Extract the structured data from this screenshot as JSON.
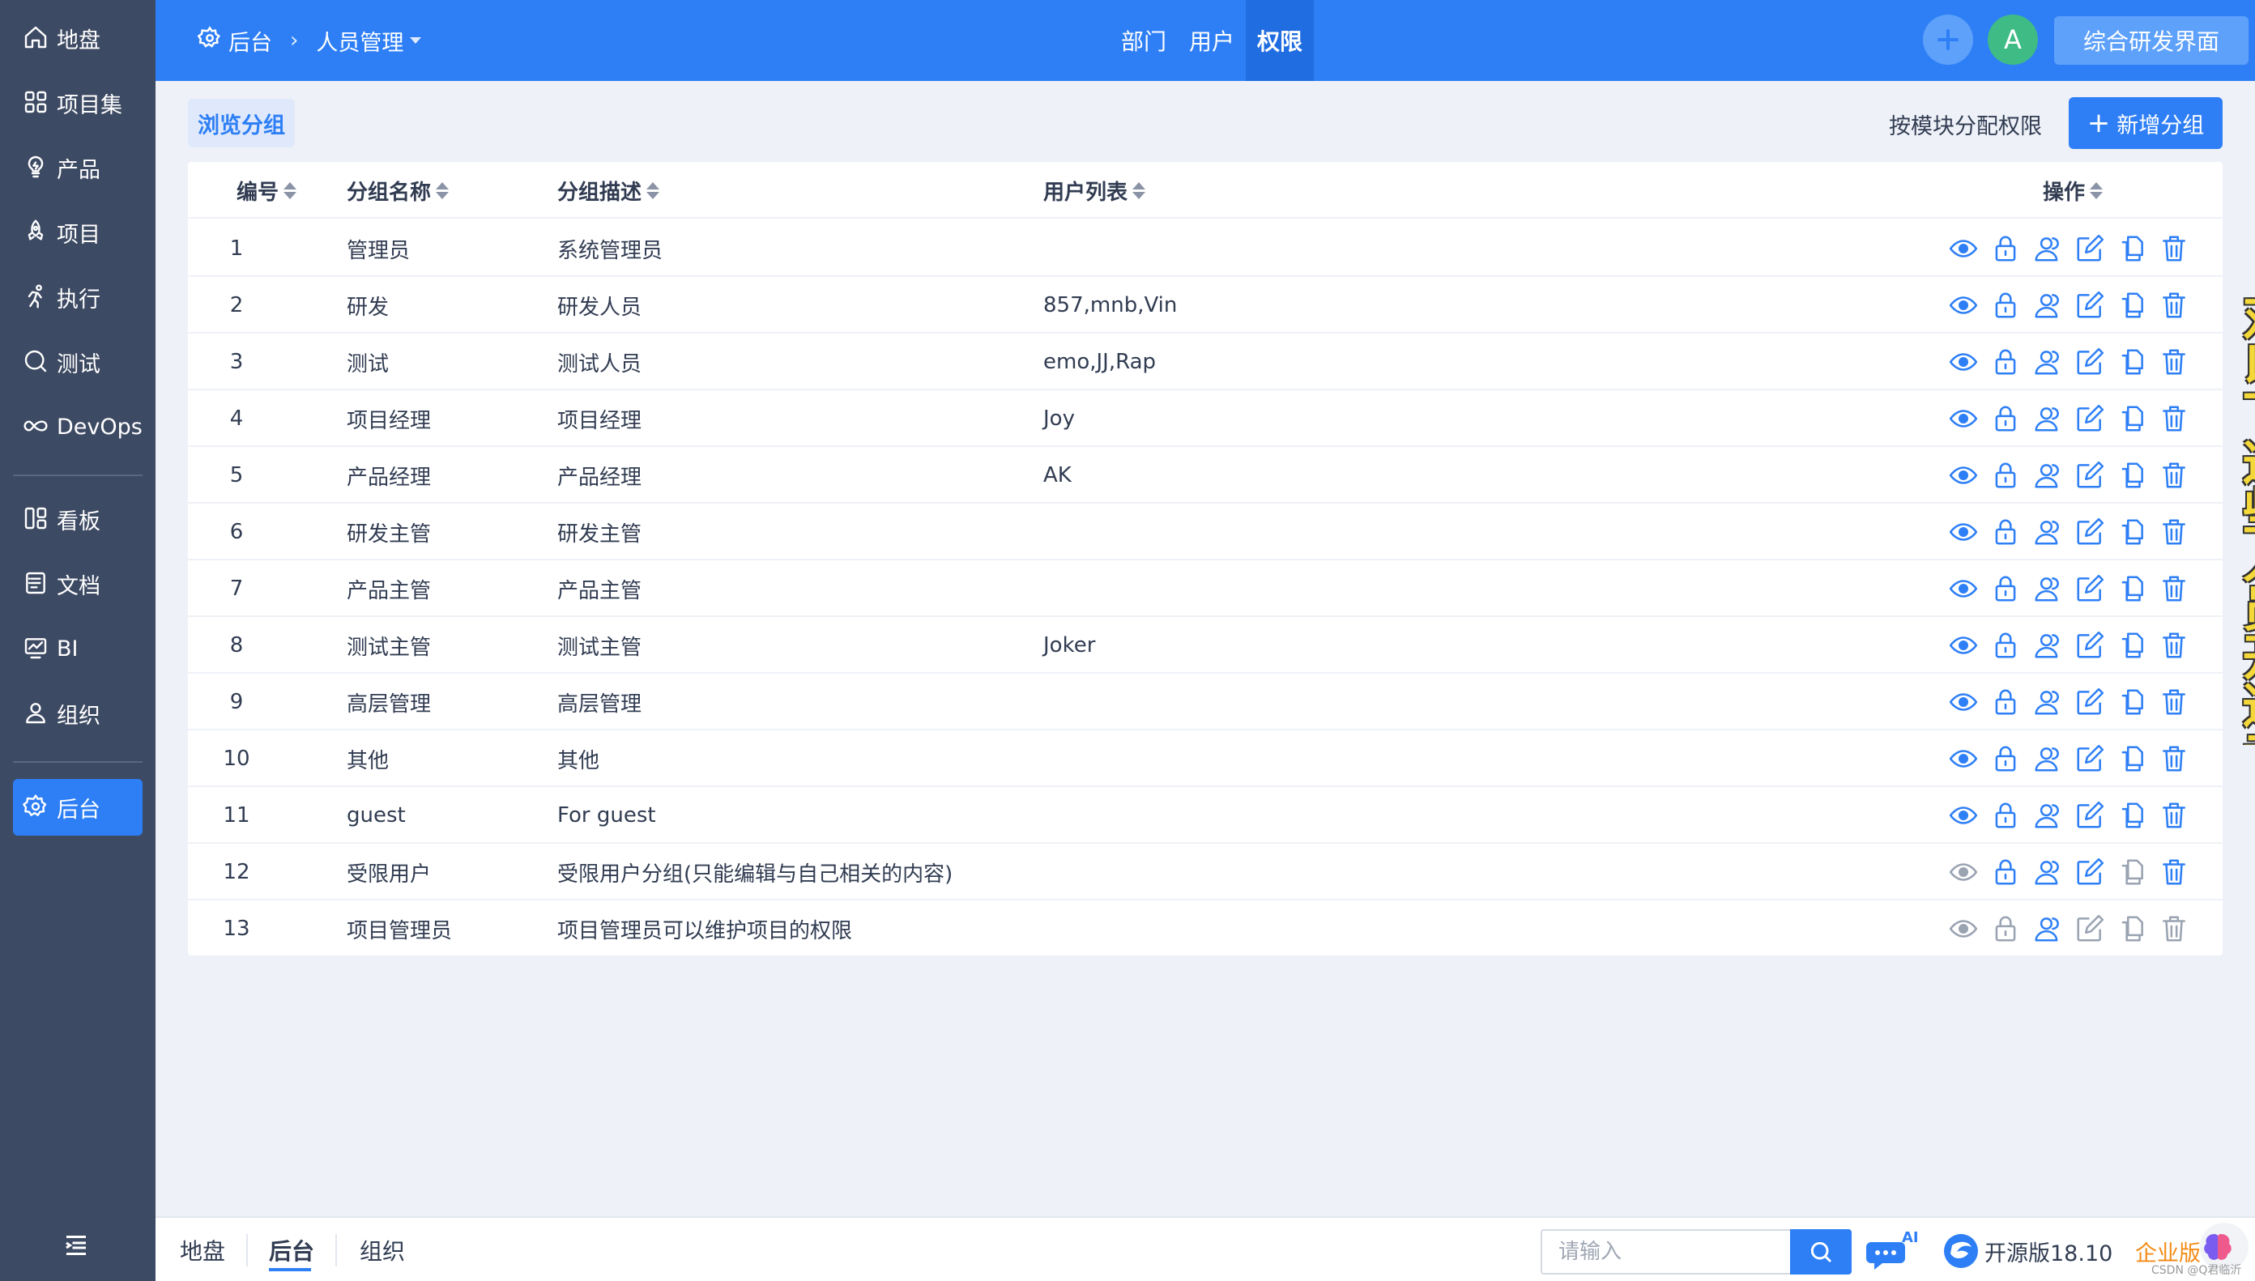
{
  "colors": {
    "primary": "#2e7ff6",
    "sidebar_bg": "#3d4a63",
    "active_nav": "#2e7ff6",
    "avatar": "#3fbb86",
    "enterprise": "#f38b16",
    "icon_enabled": "#2e7ff6",
    "icon_disabled": "#9aa3b2"
  },
  "sidebar": {
    "items": [
      {
        "label": "地盘",
        "icon": "home-icon"
      },
      {
        "label": "项目集",
        "icon": "grid-icon"
      },
      {
        "label": "产品",
        "icon": "bulb-icon"
      },
      {
        "label": "项目",
        "icon": "rocket-icon"
      },
      {
        "label": "执行",
        "icon": "run-icon"
      },
      {
        "label": "测试",
        "icon": "search-test-icon"
      },
      {
        "label": "DevOps",
        "icon": "infinity-icon"
      },
      {
        "label": "看板",
        "icon": "kanban-icon"
      },
      {
        "label": "文档",
        "icon": "doc-icon"
      },
      {
        "label": "BI",
        "icon": "chart-icon"
      },
      {
        "label": "组织",
        "icon": "user-icon"
      },
      {
        "label": "后台",
        "icon": "gear-icon",
        "active": true
      }
    ]
  },
  "header": {
    "crumb_root": "后台",
    "crumb_current": "人员管理",
    "tabs": [
      {
        "label": "部门"
      },
      {
        "label": "用户"
      },
      {
        "label": "权限",
        "active": true
      }
    ],
    "avatar_letter": "A",
    "switch_label": "综合研发界面"
  },
  "toolbar": {
    "browse_label": "浏览分组",
    "assign_label": "按模块分配权限",
    "add_label": "新增分组"
  },
  "table": {
    "columns": [
      "编号",
      "分组名称",
      "分组描述",
      "用户列表",
      "操作"
    ],
    "rows": [
      {
        "id": "1",
        "name": "管理员",
        "desc": "系统管理员",
        "users": "",
        "disabled": []
      },
      {
        "id": "2",
        "name": "研发",
        "desc": "研发人员",
        "users": "857,mnb,Vin",
        "disabled": []
      },
      {
        "id": "3",
        "name": "测试",
        "desc": "测试人员",
        "users": "emo,JJ,Rap",
        "disabled": []
      },
      {
        "id": "4",
        "name": "项目经理",
        "desc": "项目经理",
        "users": "Joy",
        "disabled": []
      },
      {
        "id": "5",
        "name": "产品经理",
        "desc": "产品经理",
        "users": "AK",
        "disabled": []
      },
      {
        "id": "6",
        "name": "研发主管",
        "desc": "研发主管",
        "users": "",
        "disabled": []
      },
      {
        "id": "7",
        "name": "产品主管",
        "desc": "产品主管",
        "users": "",
        "disabled": []
      },
      {
        "id": "8",
        "name": "测试主管",
        "desc": "测试主管",
        "users": "Joker",
        "disabled": []
      },
      {
        "id": "9",
        "name": "高层管理",
        "desc": "高层管理",
        "users": "",
        "disabled": []
      },
      {
        "id": "10",
        "name": "其他",
        "desc": "其他",
        "users": "",
        "disabled": []
      },
      {
        "id": "11",
        "name": "guest",
        "desc": "For guest",
        "users": "",
        "disabled": []
      },
      {
        "id": "12",
        "name": "受限用户",
        "desc": "受限用户分组(只能编辑与自己相关的内容)",
        "users": "",
        "disabled": [
          "view",
          "copy"
        ]
      },
      {
        "id": "13",
        "name": "项目管理员",
        "desc": "项目管理员可以维护项目的权限",
        "users": "",
        "disabled": [
          "view",
          "lock",
          "edit",
          "copy",
          "delete"
        ]
      }
    ],
    "action_icons": [
      "eye-icon",
      "lock-icon",
      "users-icon",
      "edit-icon",
      "copy-icon",
      "trash-icon"
    ]
  },
  "footer": {
    "tabs": [
      {
        "label": "地盘"
      },
      {
        "label": "后台",
        "active": true
      },
      {
        "label": "组织"
      }
    ],
    "search_placeholder": "请输入",
    "ai_badge": "AI",
    "version": "开源版18.10",
    "enterprise": "企业版",
    "watermark": "CSDN @Q君临沂"
  },
  "overlay": {
    "vertical_text": "对以下这些人员开通专"
  }
}
